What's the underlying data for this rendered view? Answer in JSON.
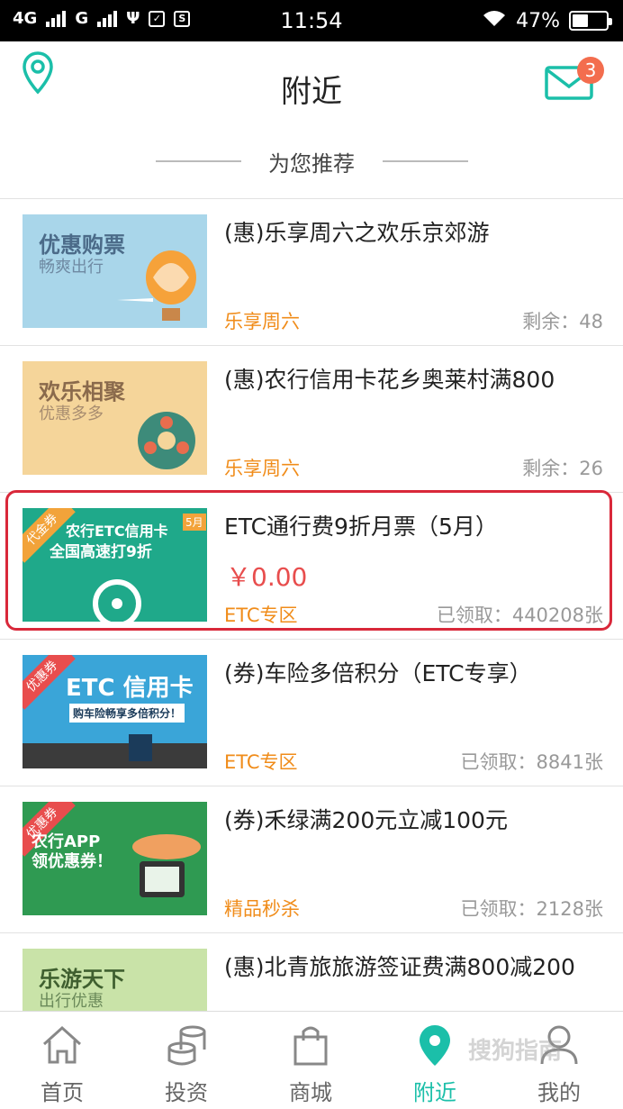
{
  "status_bar": {
    "network1": "4G",
    "network2": "G",
    "time": "11:54",
    "battery": "47%",
    "battery_level": 0.47
  },
  "header": {
    "title": "附近",
    "mail_badge": "3"
  },
  "recommend": {
    "label": "为您推荐"
  },
  "items": [
    {
      "title": "(惠)乐享周六之欢乐京郊游",
      "thumb_title": "优惠购票",
      "thumb_sub": "畅爽出行",
      "tag": "乐享周六",
      "stat": "剩余：48"
    },
    {
      "title": "(惠)农行信用卡花乡奥莱村满800",
      "thumb_title": "欢乐相聚",
      "thumb_sub": "优惠多多",
      "tag": "乐享周六",
      "stat": "剩余：26"
    },
    {
      "title": "ETC通行费9折月票（5月）",
      "thumb_title": "农行ETC信用卡",
      "thumb_sub": "全国高速打9折",
      "thumb_ribbon": "代金券",
      "thumb_month": "5月",
      "price": "￥0.00",
      "tag": "ETC专区",
      "stat": "已领取：440208张"
    },
    {
      "title": "(券)车险多倍积分（ETC专享）",
      "thumb_title": "ETC 信用卡",
      "thumb_sub": "购车险畅享多倍积分！",
      "thumb_ribbon": "优惠券",
      "tag": "ETC专区",
      "stat": "已领取：8841张"
    },
    {
      "title": "(券)禾绿满200元立减100元",
      "thumb_title": "农行APP",
      "thumb_sub": "领优惠券！",
      "thumb_ribbon": "优惠券",
      "tag": "精品秒杀",
      "stat": "已领取：2128张"
    },
    {
      "title": "(惠)北青旅旅游签证费满800减200",
      "thumb_title": "乐游天下",
      "thumb_sub": "出行优惠",
      "tag": "",
      "stat": ""
    }
  ],
  "tabs": [
    {
      "label": "首页",
      "icon": "home-icon"
    },
    {
      "label": "投资",
      "icon": "coins-icon"
    },
    {
      "label": "商城",
      "icon": "shopping-bag-icon"
    },
    {
      "label": "附近",
      "icon": "location-pin-icon"
    },
    {
      "label": "我的",
      "icon": "user-icon"
    }
  ],
  "watermark": "搜狗指南",
  "colors": {
    "accent": "#1bbfa9",
    "price": "#e84d4d",
    "tag": "#f08c1a",
    "badge": "#f36d4e",
    "highlight": "#d9283a"
  }
}
